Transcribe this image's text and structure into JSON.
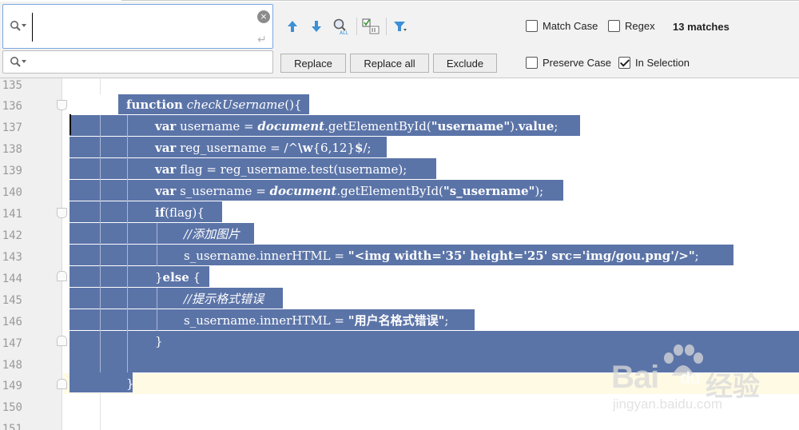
{
  "find_panel": {
    "search_value": "",
    "replace_value": "",
    "options": {
      "match_case": {
        "label": "Match Case",
        "checked": false
      },
      "regex": {
        "label": "Regex",
        "checked": false
      },
      "preserve_case": {
        "label": "Preserve Case",
        "checked": false
      },
      "in_selection": {
        "label": "In Selection",
        "checked": true
      }
    },
    "matches_label": "13 matches",
    "buttons": {
      "replace": "Replace",
      "replace_all": "Replace all",
      "exclude": "Exclude"
    },
    "toolbar_icons": [
      "previous-occurrence-icon",
      "next-occurrence-icon",
      "find-all-occurrences-icon",
      "select-all-occurrences-icon",
      "filter-icon"
    ],
    "clear_icon": "×",
    "newline_icon": "↵"
  },
  "editor": {
    "line_numbers": [
      "135",
      "136",
      "137",
      "138",
      "139",
      "140",
      "141",
      "142",
      "143",
      "144",
      "145",
      "146",
      "147",
      "148",
      "149",
      "150",
      "151"
    ],
    "lines": {
      "l136": {
        "kw": "function",
        "name": "checkUsername",
        "rest": "(){"
      },
      "l137": {
        "kw": "var",
        "a": " username = ",
        "doc": "document",
        "b": ".getElementById(",
        "str": "\"username\"",
        "c": ").",
        "prop": "value",
        "d": ";"
      },
      "l138": {
        "kw": "var",
        "a": " reg_username = /^",
        "esc": "\\w",
        "b": "{6,12}",
        "dollar": "$",
        "c": "/;"
      },
      "l139": {
        "kw": "var",
        "a": " flag = reg_username.test(username);"
      },
      "l140": {
        "kw": "var",
        "a": " s_username = ",
        "doc": "document",
        "b": ".getElementById(",
        "str": "\"s_username\"",
        "c": ");"
      },
      "l141": {
        "kw": "if",
        "a": "(flag){"
      },
      "l142": {
        "comment": "//添加图片"
      },
      "l143": {
        "a": "s_username.innerHTML = ",
        "str": "\"<img width='35' height='25' src='img/gou.png'/>\"",
        "b": ";"
      },
      "l144": {
        "a": "}",
        "kw": "else",
        "b": " {"
      },
      "l145": {
        "comment": "//提示格式错误"
      },
      "l146": {
        "a": "s_username.innerHTML = ",
        "str": "\"用户名格式错误\"",
        "b": ";"
      },
      "l147": {
        "a": "}"
      },
      "l149": {
        "a": "}"
      }
    },
    "colors": {
      "selection": "#5b74a8",
      "current_line": "#fffae3",
      "gutter": "#f0f0f0"
    }
  },
  "watermark": {
    "brand_latin": "Bai",
    "brand_paw_letter": "du",
    "brand_cjk": "经验",
    "url": "jingyan.baidu.com"
  }
}
